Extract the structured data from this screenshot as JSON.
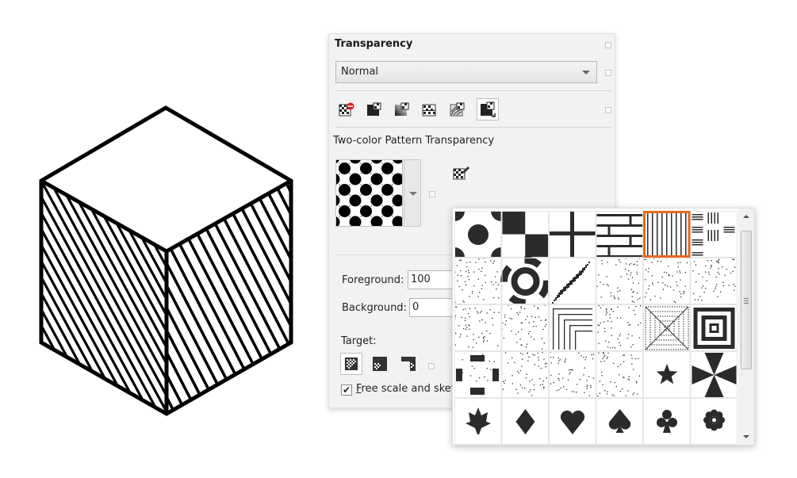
{
  "panel": {
    "title": "Transparency",
    "blend_mode": {
      "value": "Normal",
      "options_visible": [
        "Normal"
      ]
    },
    "transparency_types": [
      {
        "name": "no-transparency",
        "icon": "no-transparency-icon",
        "selected": false
      },
      {
        "name": "uniform",
        "icon": "uniform-transparency-icon",
        "selected": false
      },
      {
        "name": "fountain",
        "icon": "fountain-transparency-icon",
        "selected": false
      },
      {
        "name": "vector-pattern",
        "icon": "vector-pattern-transparency-icon",
        "selected": false
      },
      {
        "name": "bitmap-pattern",
        "icon": "bitmap-pattern-transparency-icon",
        "selected": false
      },
      {
        "name": "two-color-pattern",
        "icon": "two-color-pattern-transparency-icon",
        "selected": true
      }
    ],
    "subtitle": "Two-color Pattern Transparency",
    "foreground_label": "Foreground:",
    "foreground_value": "100",
    "background_label": "Background:",
    "background_value": "0",
    "target_label": "Target:",
    "targets": [
      {
        "name": "fill-and-outline",
        "icon": "fill-and-outline-target-icon",
        "selected": true
      },
      {
        "name": "fill",
        "icon": "fill-target-icon",
        "selected": false
      },
      {
        "name": "outline",
        "icon": "outline-target-icon",
        "selected": false
      }
    ],
    "free_scale_label": "Free scale and skew",
    "free_scale_checked": true
  },
  "pattern_picker": {
    "selected_index": 4,
    "patterns": [
      "dots-circle",
      "checkerboard",
      "cross",
      "bricks",
      "vertical-lines",
      "mixed-lines",
      "diagonal-dots",
      "ring",
      "diagonal-halftone",
      "scattered-dots",
      "dotted-ornament",
      "dotted-scatter",
      "dotted-noise",
      "dotted-noise-2",
      "dotted-corner",
      "dotted-noise-3",
      "dotted-pyramid",
      "concentric-squares",
      "octagon-blocks",
      "dotted-branches",
      "dotted-grid",
      "dotted-chevrons",
      "star",
      "pinwheel",
      "maple-leaf",
      "diamond",
      "heart",
      "spade",
      "club",
      "flower"
    ],
    "highlight_color": "#e8681c"
  },
  "colors": {
    "accent": "#e8681c"
  }
}
